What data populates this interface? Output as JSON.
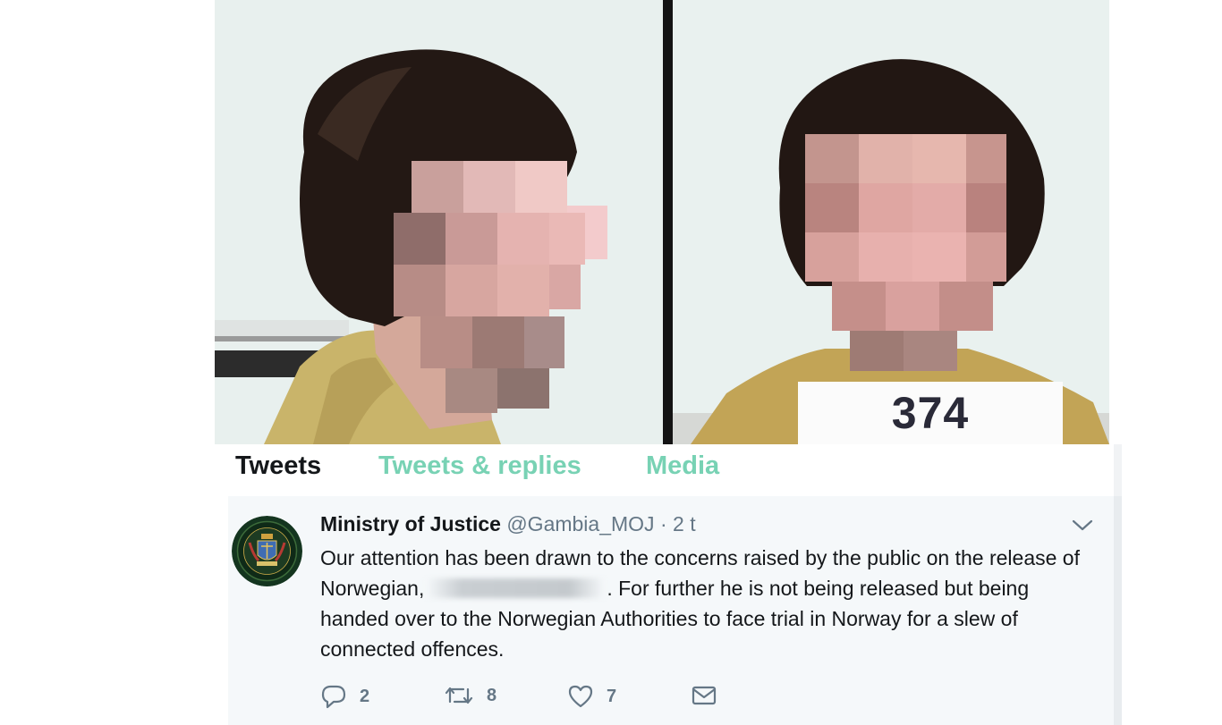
{
  "photo": {
    "booking_number": "374"
  },
  "profile_tabs": [
    {
      "label": "Tweets",
      "active": true
    },
    {
      "label": "Tweets & replies",
      "active": false
    },
    {
      "label": "Media",
      "active": false
    }
  ],
  "tweet": {
    "display_name": "Ministry of Justice",
    "handle": "@Gambia_MOJ",
    "separator": " · ",
    "time": "2 t",
    "text_before": "Our attention has been drawn to the concerns raised by the public on the release of Norwegian,",
    "text_after": ". For further he is not being released but being handed over to the Norwegian Authorities to face trial in Norway for a slew of connected offences.",
    "actions": {
      "replies": "2",
      "retweets": "8",
      "likes": "7"
    }
  },
  "colors": {
    "tab_inactive": "#78d2b4",
    "tab_active": "#14171a",
    "meta_gray": "#657786",
    "tweet_bg": "#f5f8fa"
  },
  "icons": [
    "chevron-down-icon",
    "reply-icon",
    "retweet-icon",
    "like-icon",
    "message-icon"
  ]
}
